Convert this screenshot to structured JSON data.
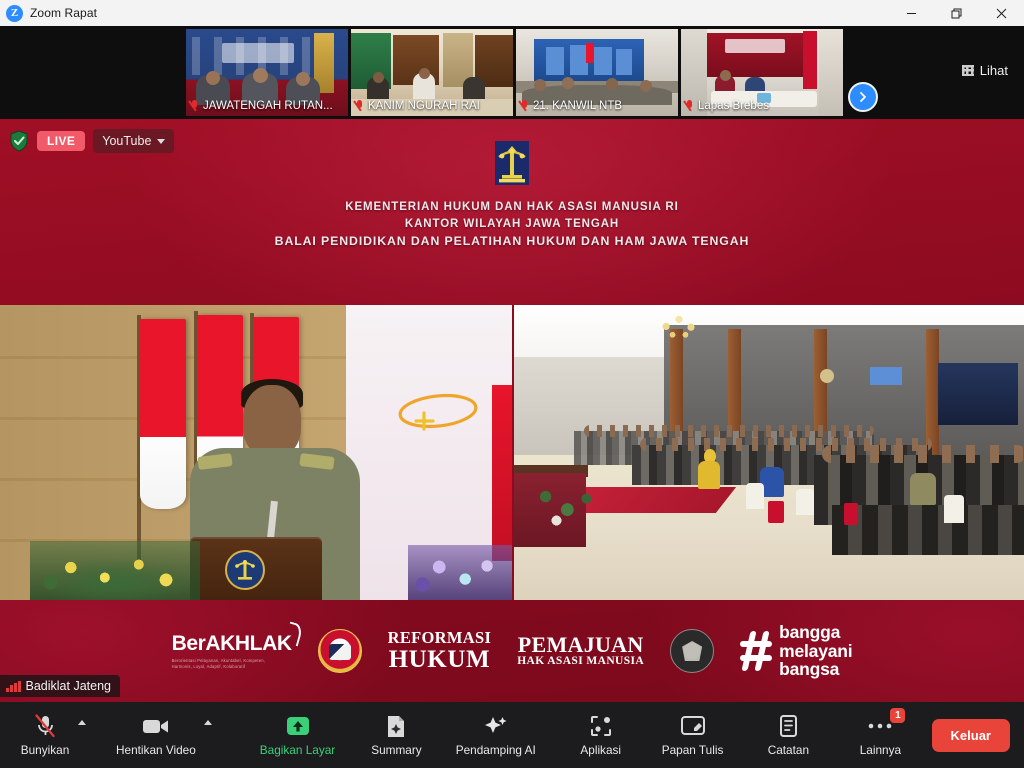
{
  "window": {
    "title": "Zoom Rapat",
    "logo_letter": "Z",
    "minimize_label": "—",
    "maximize_label": "❐",
    "close_label": "✕"
  },
  "filmstrip": {
    "view_button_label": "Lihat",
    "view_icon": "grid-icon",
    "next_icon": "chevron-right-icon",
    "thumbnails": [
      {
        "name": "JAWATENGAH RUTAN...",
        "mic": "mic-off-icon"
      },
      {
        "name": "KANIM NGURAH RAI",
        "mic": "mic-off-icon"
      },
      {
        "name": "21. KANWIL NTB",
        "mic": "mic-off-icon"
      },
      {
        "name": "Lapas Brebes",
        "mic": "mic-off-icon"
      }
    ]
  },
  "live": {
    "shield_icon": "shield-check-icon",
    "status_label": "LIVE",
    "platform_label": "YouTube",
    "caret_icon": "chevron-down-icon"
  },
  "slide": {
    "logo_name": "kemenkumham-logo",
    "line1": "KEMENTERIAN HUKUM DAN HAK ASASI MANUSIA RI",
    "line2": "KANTOR WILAYAH JAWA TENGAH",
    "line3": "BALAI PENDIDIKAN DAN PELATIHAN HUKUM DAN HAM JAWA TENGAH",
    "annotation": "orange-circle-scribble"
  },
  "videos": [
    {
      "name": "speaker-podium-feed",
      "description": "Speaker in khaki uniform at wooden podium with Indonesian flags"
    },
    {
      "name": "audience-hall-feed",
      "description": "Auditorium with rows of seated attendees"
    }
  ],
  "banner": {
    "berakhlak_main": "BerAKHLAK",
    "berakhlak_sub": "Berorientasi Pelayanan, Akuntabel, Kompeten, Harmonis, Loyal, Adaptif, Kolaboratif",
    "pancasila_seal": "garuda-pancasila-seal",
    "reformasi_line1": "REFORMASI",
    "reformasi_line2": "HUKUM",
    "pemajuan_line1": "PEMAJUAN",
    "pemajuan_line2": "HAK ASASI MANUSIA",
    "dark_seal": "institution-seal",
    "bangga_line1": "bangga",
    "bangga_line2": "melayani",
    "bangga_line3": "bangsa",
    "hash_icon": "hashtag-icon"
  },
  "name_label": {
    "text": "Badiklat Jateng",
    "icon": "signal-bars-icon"
  },
  "toolbar": {
    "items": [
      {
        "label": "Bunyikan",
        "icon": "mic-off-icon",
        "has_caret": true,
        "green": false,
        "badge": null
      },
      {
        "label": "Hentikan Video",
        "icon": "video-camera-icon",
        "has_caret": true,
        "green": false,
        "badge": null
      },
      {
        "label": "Bagikan Layar",
        "icon": "share-screen-icon",
        "has_caret": false,
        "green": true,
        "badge": null
      },
      {
        "label": "Summary",
        "icon": "summary-doc-icon",
        "has_caret": false,
        "green": false,
        "badge": null
      },
      {
        "label": "Pendamping AI",
        "icon": "ai-sparkle-icon",
        "has_caret": false,
        "green": false,
        "badge": null
      },
      {
        "label": "Aplikasi",
        "icon": "apps-icon",
        "has_caret": false,
        "green": false,
        "badge": null
      },
      {
        "label": "Papan Tulis",
        "icon": "whiteboard-icon",
        "has_caret": false,
        "green": false,
        "badge": null
      },
      {
        "label": "Catatan",
        "icon": "notes-icon",
        "has_caret": false,
        "green": false,
        "badge": null
      },
      {
        "label": "Lainnya",
        "icon": "more-dots-icon",
        "has_caret": false,
        "green": false,
        "badge": "1"
      }
    ],
    "leave_label": "Keluar"
  },
  "colors": {
    "brand_red": "#8d0b20",
    "accent_blue": "#2d8cff",
    "live_red": "#f05a69",
    "share_green": "#3ad07a",
    "leave_red": "#e8443a"
  }
}
